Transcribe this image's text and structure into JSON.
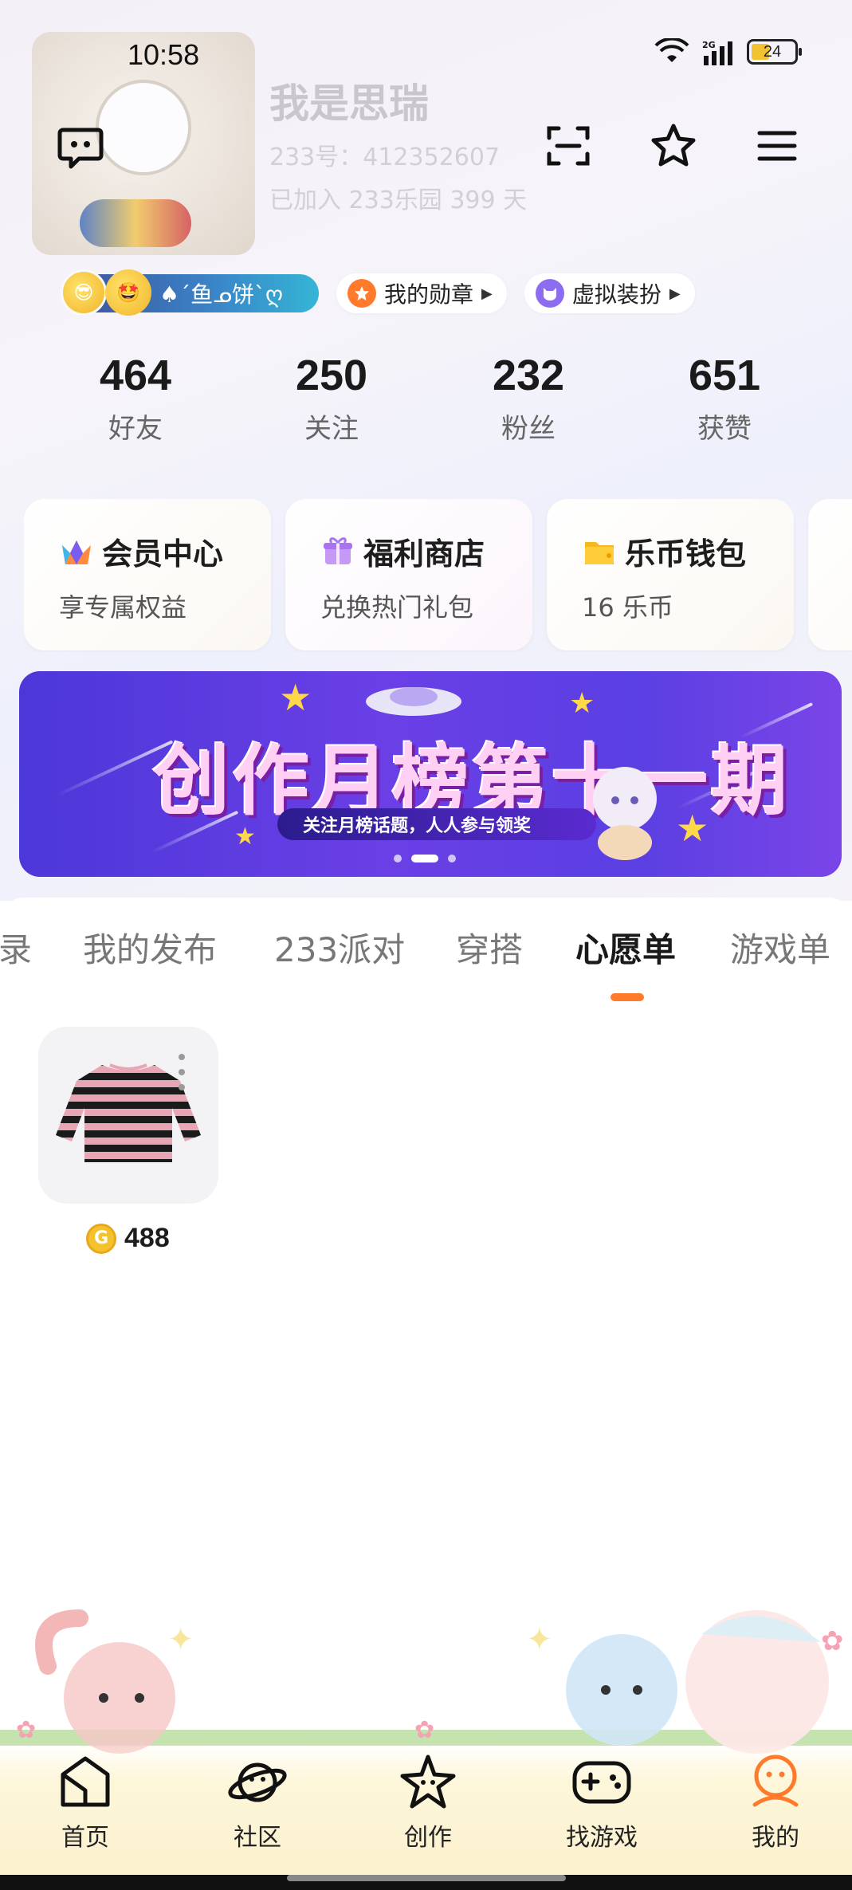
{
  "status_bar": {
    "time": "10:58",
    "network": "2G",
    "battery": "24"
  },
  "profile": {
    "name": "我是思瑞",
    "id_line": "233号：412352607",
    "joined_line": "已加入 233乐园 399 天"
  },
  "top_actions": {
    "icons": [
      "message-icon",
      "scan-icon",
      "star-icon",
      "menu-icon"
    ]
  },
  "badges": {
    "level_text": "♠´鱼ᓄ饼`ღ",
    "medals_label": "我的勋章",
    "avatar_dressup_label": "虚拟装扮"
  },
  "stats": [
    {
      "value": "464",
      "label": "好友"
    },
    {
      "value": "250",
      "label": "关注"
    },
    {
      "value": "232",
      "label": "粉丝"
    },
    {
      "value": "651",
      "label": "获赞"
    }
  ],
  "cards": [
    {
      "title": "会员中心",
      "subtitle": "享专属权益",
      "icon": "crown-icon"
    },
    {
      "title": "福利商店",
      "subtitle": "兑换热门礼包",
      "icon": "gift-icon"
    },
    {
      "title": "乐币钱包",
      "subtitle": "16 乐币",
      "icon": "wallet-icon"
    }
  ],
  "banner": {
    "title": "创作月榜第十一期",
    "subtitle": "关注月榜话题，人人参与领奖",
    "page_count": 3,
    "active_page": 2
  },
  "tabs": {
    "items": [
      "录",
      "我的发布",
      "233派对",
      "穿搭",
      "心愿单",
      "游戏单"
    ],
    "active": "心愿单"
  },
  "wishlist": {
    "items": [
      {
        "price": "488",
        "coin_glyph": "G"
      }
    ]
  },
  "bottom_nav": {
    "items": [
      {
        "label": "首页",
        "icon": "home-icon"
      },
      {
        "label": "社区",
        "icon": "planet-icon"
      },
      {
        "label": "创作",
        "icon": "create-star-icon"
      },
      {
        "label": "找游戏",
        "icon": "gamepad-icon"
      },
      {
        "label": "我的",
        "icon": "profile-icon"
      }
    ],
    "active": "我的"
  },
  "colors": {
    "accent": "#ff7a2a",
    "banner_bg": "#5a3fe2",
    "coin": "#f4c22f"
  }
}
